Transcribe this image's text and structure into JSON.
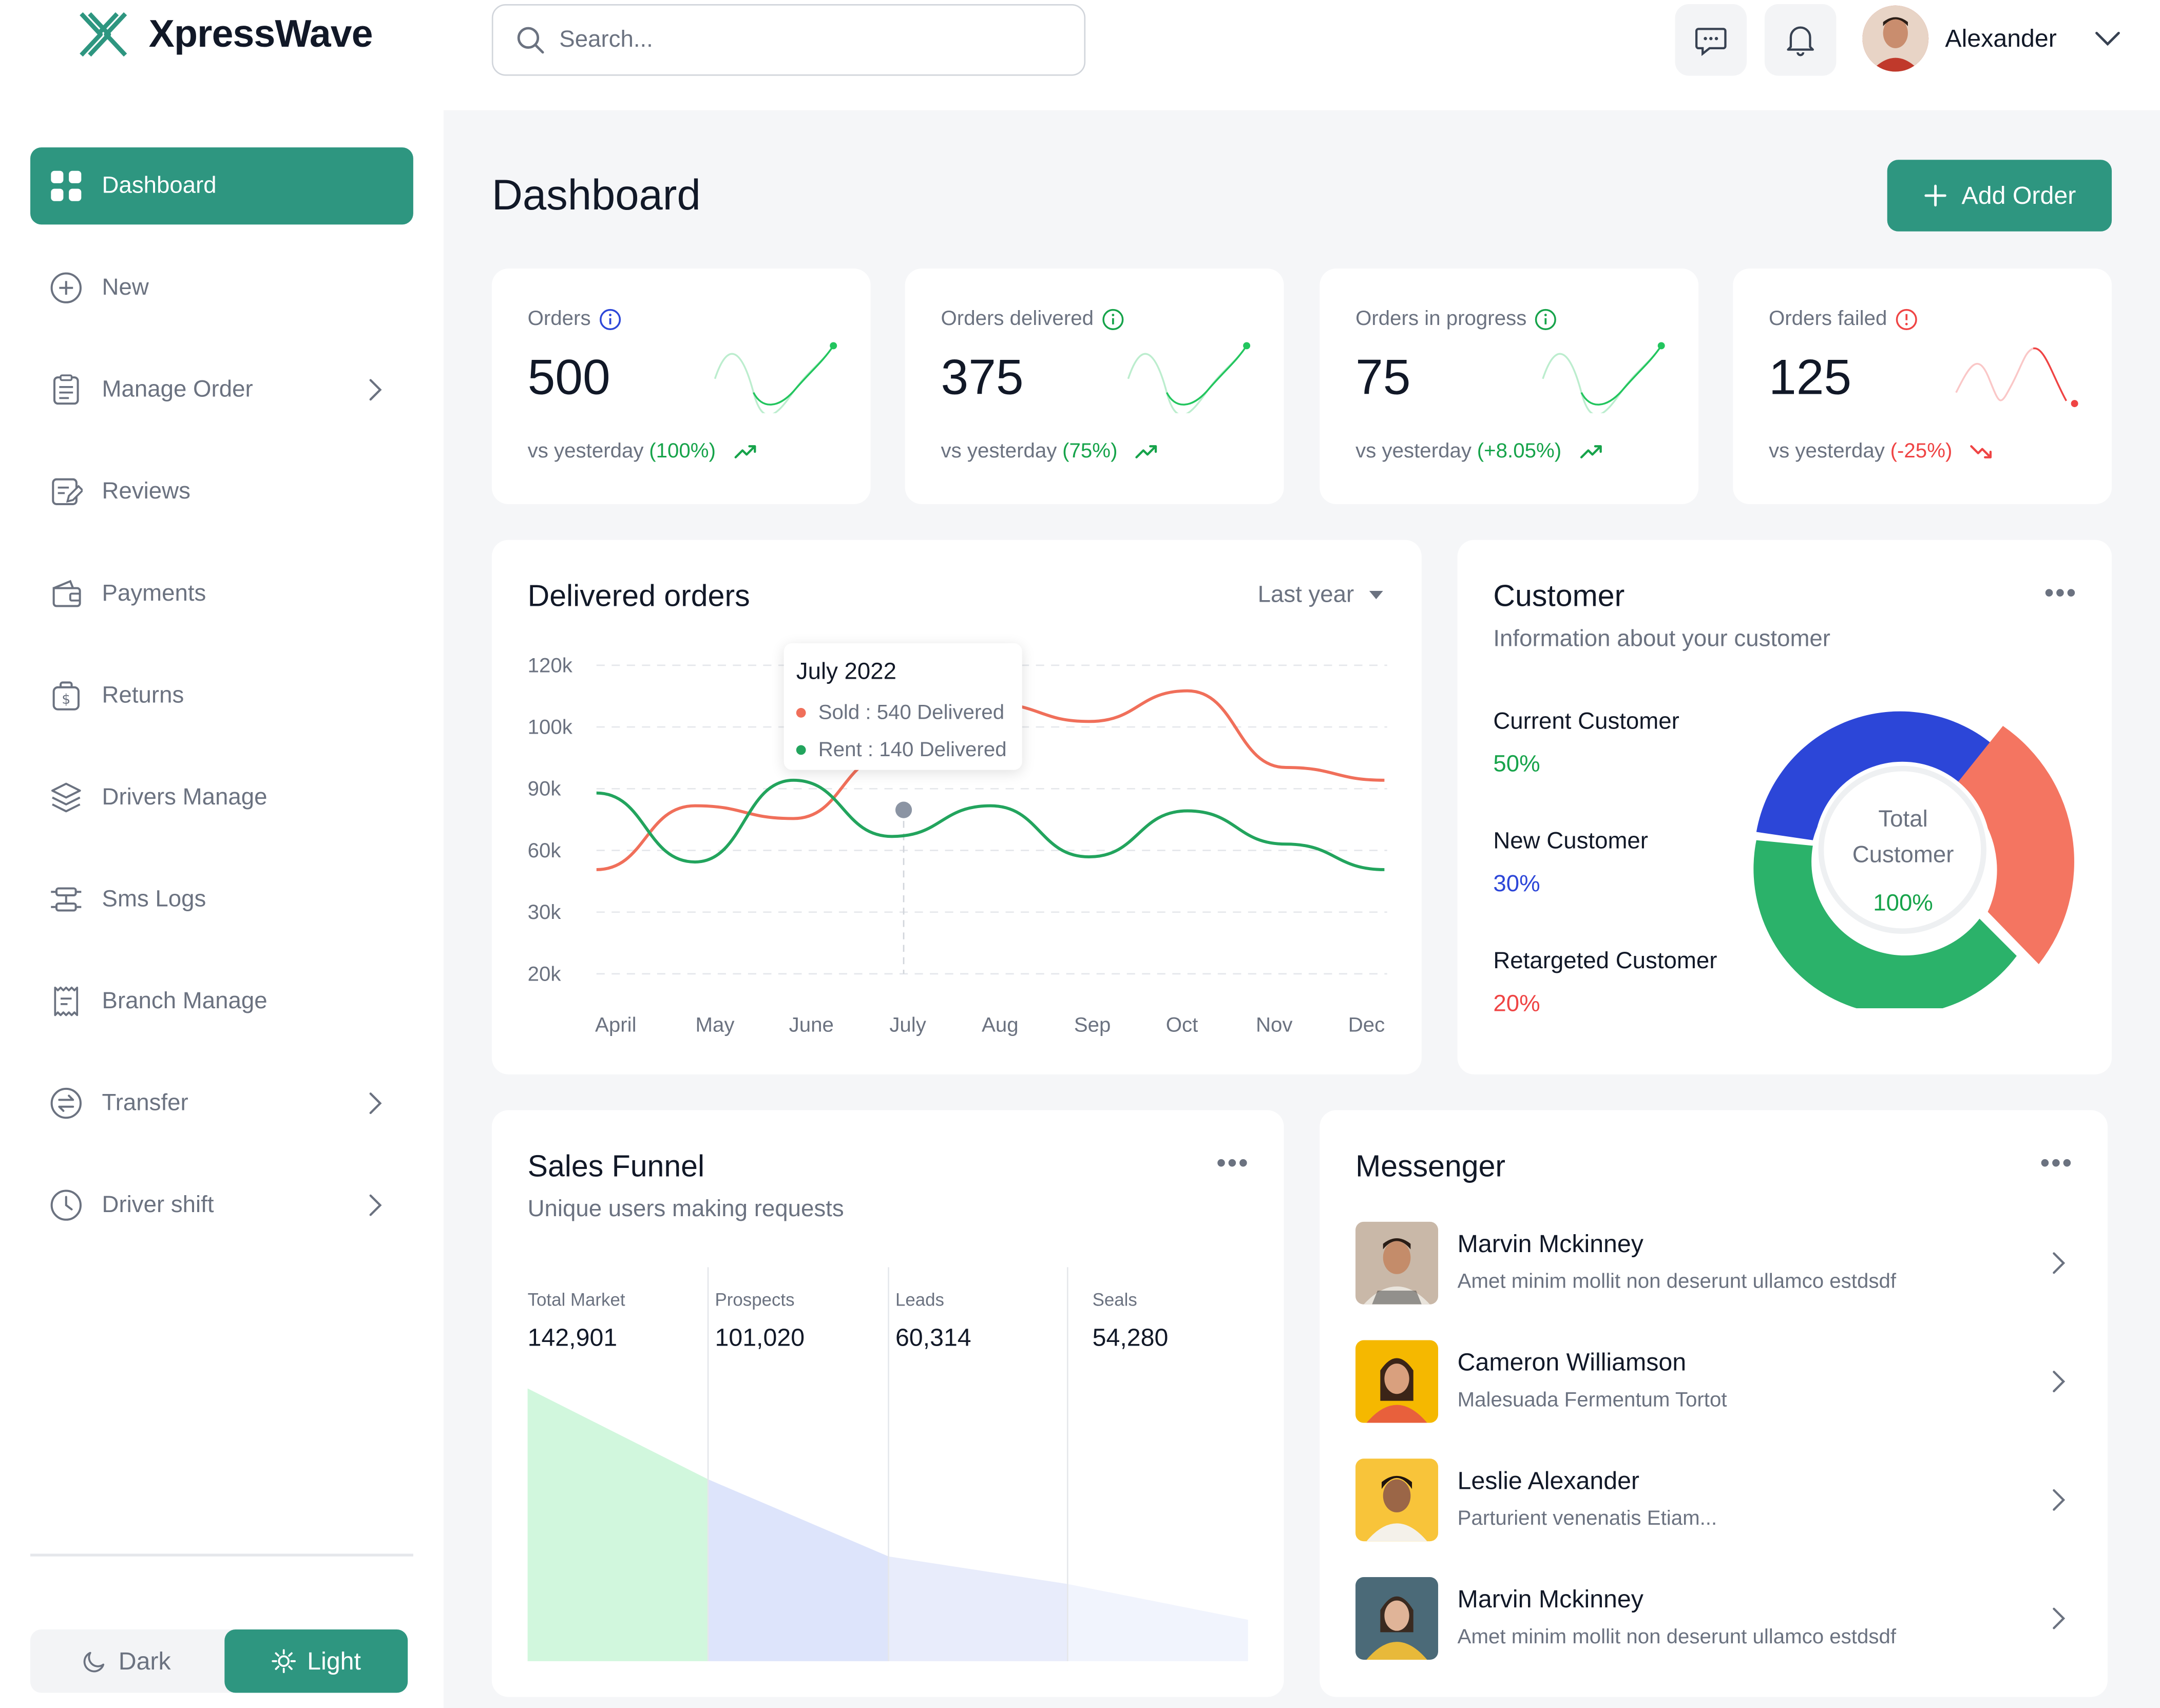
{
  "app": {
    "name": "XpressWave"
  },
  "header": {
    "search_placeholder": "Search...",
    "user_name": "Alexander"
  },
  "sidebar": {
    "items": [
      {
        "label": "Dashboard",
        "icon": "grid-icon",
        "active": true
      },
      {
        "label": "New",
        "icon": "plus-circle-icon"
      },
      {
        "label": "Manage Order",
        "icon": "clipboard-icon",
        "has_submenu": true
      },
      {
        "label": "Reviews",
        "icon": "edit-icon"
      },
      {
        "label": "Payments",
        "icon": "wallet-icon"
      },
      {
        "label": "Returns",
        "icon": "money-bag-icon"
      },
      {
        "label": "Drivers Manage",
        "icon": "layers-icon"
      },
      {
        "label": "Sms Logs",
        "icon": "sliders-icon"
      },
      {
        "label": "Branch Manage",
        "icon": "receipt-icon"
      },
      {
        "label": "Transfer",
        "icon": "transfer-icon",
        "has_submenu": true
      },
      {
        "label": "Driver shift",
        "icon": "clock-icon",
        "has_submenu": true
      }
    ],
    "theme": {
      "dark_label": "Dark",
      "light_label": "Light",
      "selected": "Light"
    }
  },
  "main": {
    "title": "Dashboard",
    "add_order_label": "Add Order"
  },
  "stats": [
    {
      "label": "Orders",
      "value": "500",
      "compare": "vs yesterday",
      "change": "(100%)",
      "trend": "up",
      "color": "#22c55e"
    },
    {
      "label": "Orders delivered",
      "value": "375",
      "compare": "vs yesterday",
      "change": "(75%)",
      "trend": "up",
      "color": "#22c55e"
    },
    {
      "label": "Orders in progress",
      "value": "75",
      "compare": "vs yesterday",
      "change": "(+8.05%)",
      "trend": "up",
      "color": "#22c55e"
    },
    {
      "label": "Orders failed",
      "value": "125",
      "compare": "vs yesterday",
      "change": "(-25%)",
      "trend": "down",
      "color": "#ef4444"
    }
  ],
  "delivered_orders": {
    "title": "Delivered orders",
    "range_label": "Last year",
    "tooltip": {
      "title": "July 2022",
      "sold": "Sold : 540 Delivered",
      "rent": "Rent : 140 Delivered"
    }
  },
  "chart_data": {
    "type": "line",
    "categories": [
      "April",
      "May",
      "June",
      "July",
      "Aug",
      "Sep",
      "Oct",
      "Nov",
      "Dec"
    ],
    "yticks": [
      "120k",
      "100k",
      "90k",
      "60k",
      "30k",
      "20k"
    ],
    "series": [
      {
        "name": "Sold",
        "color": "#f06f5a",
        "values": [
          30,
          55,
          50,
          75,
          95,
          88,
          100,
          70,
          65
        ]
      },
      {
        "name": "Rent",
        "color": "#22a45d",
        "values": [
          60,
          33,
          65,
          43,
          55,
          35,
          53,
          40,
          30
        ]
      }
    ],
    "grid": true
  },
  "customer": {
    "title": "Customer",
    "subtitle": "Information about your customer",
    "segments": [
      {
        "label": "Current Customer",
        "value": "50%",
        "color": "#22a45d"
      },
      {
        "label": "New Customer",
        "value": "30%",
        "color": "#2c46d8"
      },
      {
        "label": "Retargeted Customer",
        "value": "20%",
        "color": "#f06f5a"
      }
    ],
    "center_label_1": "Total",
    "center_label_2": "Customer",
    "center_value": "100%"
  },
  "sales_funnel": {
    "title": "Sales Funnel",
    "subtitle": "Unique users making requests",
    "columns": [
      {
        "label": "Total Market",
        "value": "142,901",
        "color": "#d1f7dd"
      },
      {
        "label": "Prospects",
        "value": "101,020",
        "color": "#dde4fb"
      },
      {
        "label": "Leads",
        "value": "60,314",
        "color": "#e8ecfb"
      },
      {
        "label": "Seals",
        "value": "54,280",
        "color": "#f1f4fd"
      }
    ]
  },
  "messenger": {
    "title": "Messenger",
    "messages": [
      {
        "name": "Marvin Mckinney",
        "text": "Amet minim mollit non deserunt ullamco estdsdf",
        "bg": "#c9b8a8"
      },
      {
        "name": "Cameron Williamson",
        "text": "Malesuada Fermentum Tortot",
        "bg": "#f5b800"
      },
      {
        "name": "Leslie Alexander",
        "text": "Parturient venenatis Etiam...",
        "bg": "#f8c43a"
      },
      {
        "name": "Marvin Mckinney",
        "text": "Amet minim mollit non deserunt ullamco estdsdf",
        "bg": "#4b6a78"
      }
    ]
  }
}
